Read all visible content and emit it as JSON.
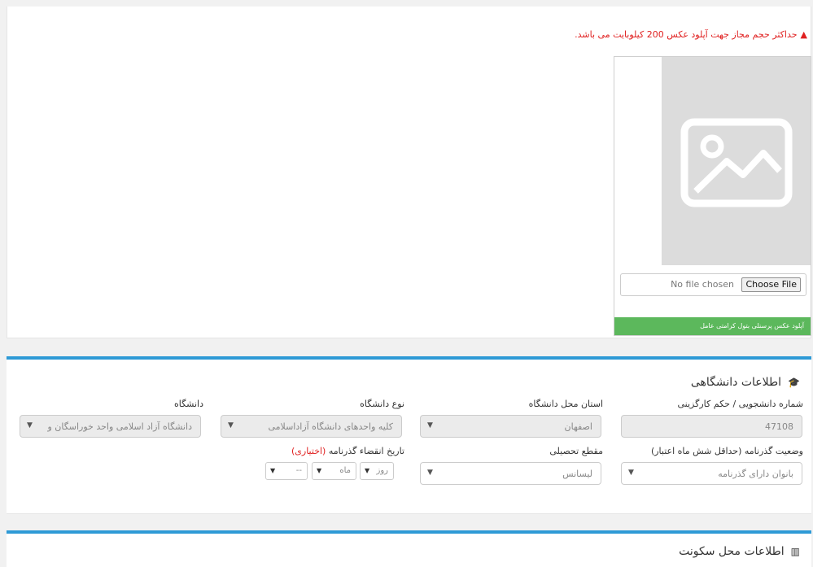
{
  "upload_panel": {
    "warning_text": "حداکثر حجم مجاز جهت آپلود عکس 200 کیلوبایت می باشد.",
    "file_status": "No file chosen",
    "choose_file_label": "Choose File",
    "upload_caption": "آپلود عکس پرسنلی بتول کرامتی عامل"
  },
  "university_section": {
    "title": "اطلاعات دانشگاهی",
    "icon": "graduation-cap-icon",
    "fields": {
      "student_number": {
        "label": "شماره دانشجویی / حکم کارگزینی",
        "value": "47108"
      },
      "province": {
        "label": "استان محل دانشگاه",
        "value": "اصفهان"
      },
      "university_type": {
        "label": "نوع دانشگاه",
        "value": "کلیه واحدهای دانشگاه آزاداسلامی"
      },
      "university": {
        "label": "دانشگاه",
        "value": "دانشگاه آزاد اسلامی واحد خوراسگان و"
      },
      "passport_status": {
        "label": "وضعیت گذرنامه (حداقل شش ماه اعتبار)",
        "value": "بانوان دارای گذرنامه"
      },
      "degree": {
        "label": "مقطع تحصیلی",
        "value": "لیسانس"
      },
      "passport_expiry": {
        "label": "تاریخ انقضاء گذرنامه",
        "optional": "(اختیاری)",
        "day": "روز",
        "month": "ماه",
        "year": "--"
      }
    }
  },
  "residence_section": {
    "title": "اطلاعات محل سکونت",
    "icon": "map-icon"
  },
  "colors": {
    "accent": "#2e9ad6",
    "success": "#5cb85c",
    "warning": "#e02020"
  }
}
